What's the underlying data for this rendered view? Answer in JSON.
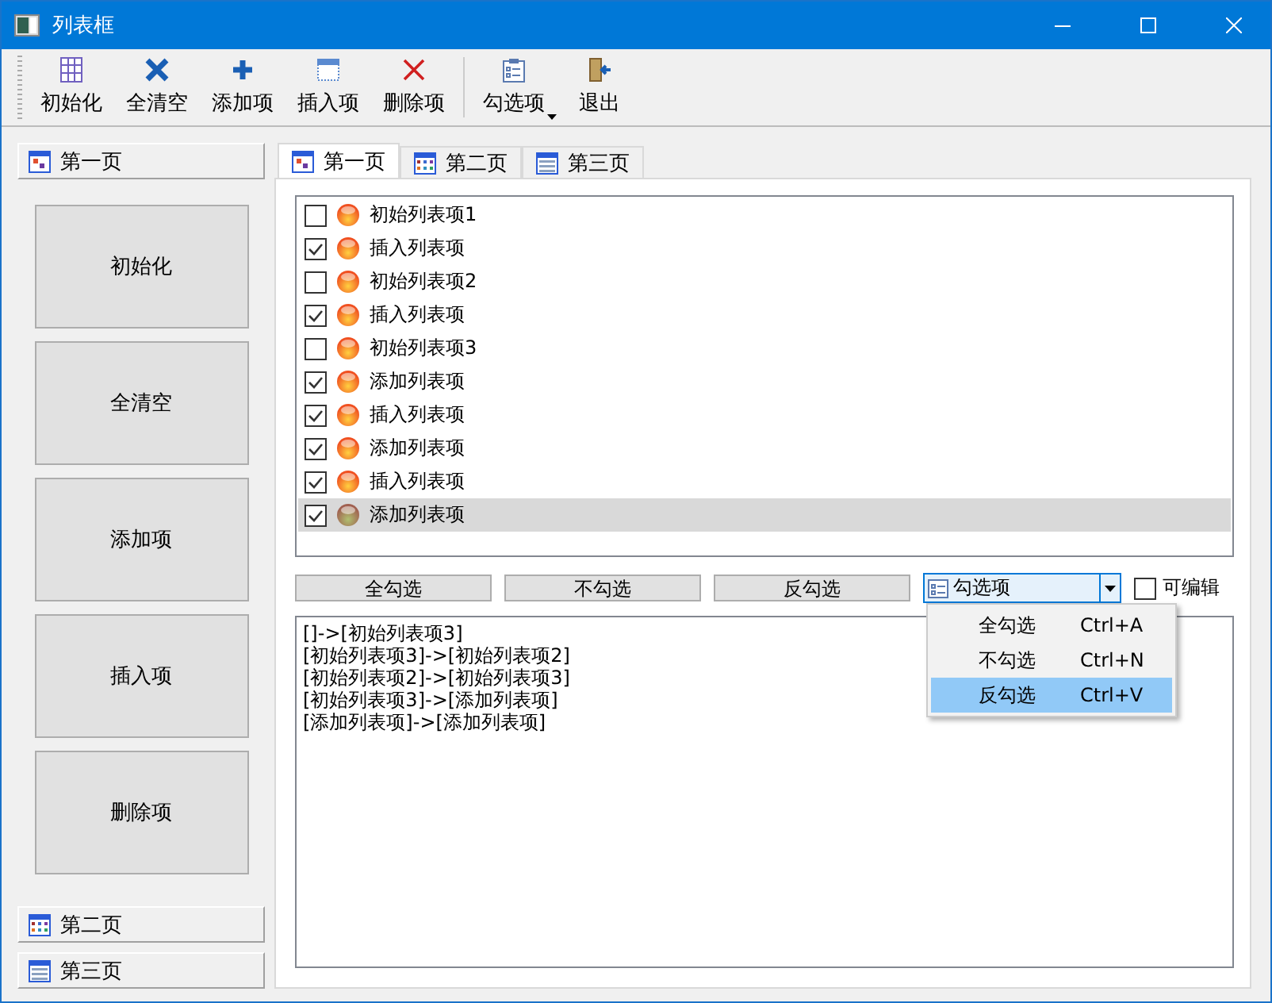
{
  "window": {
    "title": "列表框"
  },
  "toolbar": [
    {
      "label": "初始化",
      "kind": "grid"
    },
    {
      "label": "全清空",
      "kind": "cross"
    },
    {
      "label": "添加项",
      "kind": "plus"
    },
    {
      "label": "插入项",
      "kind": "insert"
    },
    {
      "label": "删除项",
      "kind": "delete"
    },
    {
      "label": "勾选项",
      "kind": "checklist",
      "dropdown": true,
      "separator_before": true
    },
    {
      "label": "退出",
      "kind": "exit"
    }
  ],
  "sidebar": {
    "sections": [
      {
        "label": "第一页",
        "buttons": [
          "初始化",
          "全清空",
          "添加项",
          "插入项",
          "删除项"
        ]
      },
      {
        "label": "第二页"
      },
      {
        "label": "第三页"
      }
    ]
  },
  "tabs": [
    {
      "label": "第一页",
      "selected": true
    },
    {
      "label": "第二页",
      "selected": false
    },
    {
      "label": "第三页",
      "selected": false
    }
  ],
  "list": [
    {
      "label": "初始列表项1",
      "checked": false,
      "selected": false
    },
    {
      "label": "插入列表项",
      "checked": true,
      "selected": false
    },
    {
      "label": "初始列表项2",
      "checked": false,
      "selected": false
    },
    {
      "label": "插入列表项",
      "checked": true,
      "selected": false
    },
    {
      "label": "初始列表项3",
      "checked": false,
      "selected": false
    },
    {
      "label": "添加列表项",
      "checked": true,
      "selected": false
    },
    {
      "label": "插入列表项",
      "checked": true,
      "selected": false
    },
    {
      "label": "添加列表项",
      "checked": true,
      "selected": false
    },
    {
      "label": "插入列表项",
      "checked": true,
      "selected": false
    },
    {
      "label": "添加列表项",
      "checked": true,
      "selected": true
    }
  ],
  "actions": [
    "全勾选",
    "不勾选",
    "反勾选"
  ],
  "combo": {
    "value": "勾选项",
    "menu": [
      {
        "label": "全勾选",
        "shortcut": "Ctrl+A",
        "selected": false
      },
      {
        "label": "不勾选",
        "shortcut": "Ctrl+N",
        "selected": false
      },
      {
        "label": "反勾选",
        "shortcut": "Ctrl+V",
        "selected": true
      }
    ]
  },
  "editable": {
    "label": "可编辑",
    "checked": false
  },
  "log": [
    "[]->[初始列表项3]",
    "[初始列表项3]->[初始列表项2]",
    "[初始列表项2]->[初始列表项3]",
    "[初始列表项3]->[添加列表项]",
    "[添加列表项]->[添加列表项]"
  ]
}
